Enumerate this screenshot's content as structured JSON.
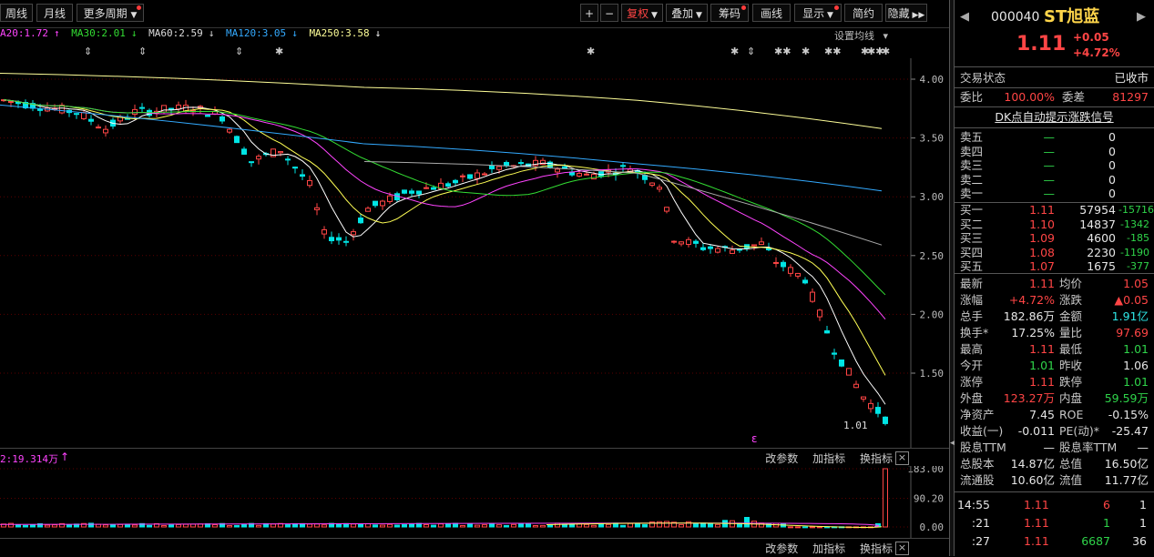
{
  "toolbar": {
    "weekly": "周线",
    "monthly": "月线",
    "more_periods": "更多周期",
    "plus": "+",
    "minus": "−",
    "fuquan": "复权",
    "overlay": "叠加",
    "chips": "筹码",
    "draw": "画线",
    "display": "显示",
    "simple": "简约",
    "hide": "隐藏"
  },
  "ma_row": {
    "ma20": "A20:1.72",
    "ma30": "MA30:2.01",
    "ma60": "MA60:2.59",
    "ma120": "MA120:3.05",
    "ma250": "MA250:3.58",
    "settings": "设置均线"
  },
  "markers": [
    "⇕",
    "⇕",
    "⇕",
    "✱",
    "✱",
    "✱",
    "⇕",
    "✱✱",
    "✱",
    "✱✱",
    "✱",
    "✱✱",
    "✱"
  ],
  "main_chart": {
    "y_ticks": [
      "4.00",
      "3.50",
      "3.00",
      "2.50",
      "2.00",
      "1.50"
    ],
    "low_label": "1.01",
    "ex_marker": "ε"
  },
  "volume": {
    "header": "2:19.314万",
    "y_ticks": [
      "183.00",
      "90.20",
      "0.00"
    ],
    "tools": [
      "改参数",
      "加指标",
      "换指标"
    ],
    "close": "×"
  },
  "stock": {
    "code": "000040",
    "name": "ST旭蓝",
    "price": "1.11",
    "change": "+0.05",
    "change_pct": "+4.72%"
  },
  "status": {
    "label": "交易状态",
    "value": "已收市",
    "weibi_label": "委比",
    "weibi": "100.00%",
    "weicha_label": "委差",
    "weicha": "81297",
    "dk": "DK点自动提示涨跌信号"
  },
  "asks": [
    {
      "label": "卖五",
      "price": "—",
      "vol": "0"
    },
    {
      "label": "卖四",
      "price": "—",
      "vol": "0"
    },
    {
      "label": "卖三",
      "price": "—",
      "vol": "0"
    },
    {
      "label": "卖二",
      "price": "—",
      "vol": "0"
    },
    {
      "label": "卖一",
      "price": "—",
      "vol": "0"
    }
  ],
  "bids": [
    {
      "label": "买一",
      "price": "1.11",
      "vol": "57954",
      "chg": "-15716"
    },
    {
      "label": "买二",
      "price": "1.10",
      "vol": "14837",
      "chg": "-1342"
    },
    {
      "label": "买三",
      "price": "1.09",
      "vol": "4600",
      "chg": "-185"
    },
    {
      "label": "买四",
      "price": "1.08",
      "vol": "2230",
      "chg": "-1190"
    },
    {
      "label": "买五",
      "price": "1.07",
      "vol": "1675",
      "chg": "-377"
    }
  ],
  "stats": [
    {
      "l1": "最新",
      "v1": "1.11",
      "c1": "red",
      "l2": "均价",
      "v2": "1.05",
      "c2": "red"
    },
    {
      "l1": "涨幅",
      "v1": "+4.72%",
      "c1": "red",
      "l2": "涨跌",
      "v2": "▲0.05",
      "c2": "red"
    },
    {
      "l1": "总手",
      "v1": "182.86万",
      "c1": "white",
      "l2": "金额",
      "v2": "1.91亿",
      "c2": "cyan"
    },
    {
      "l1": "换手*",
      "v1": "17.25%",
      "c1": "white",
      "l2": "量比",
      "v2": "97.69",
      "c2": "red"
    },
    {
      "l1": "最高",
      "v1": "1.11",
      "c1": "red",
      "l2": "最低",
      "v2": "1.01",
      "c2": "green"
    },
    {
      "l1": "今开",
      "v1": "1.01",
      "c1": "green",
      "l2": "昨收",
      "v2": "1.06",
      "c2": "white"
    },
    {
      "l1": "涨停",
      "v1": "1.11",
      "c1": "red",
      "l2": "跌停",
      "v2": "1.01",
      "c2": "green"
    },
    {
      "l1": "外盘",
      "v1": "123.27万",
      "c1": "red",
      "l2": "内盘",
      "v2": "59.59万",
      "c2": "green"
    },
    {
      "l1": "净资产",
      "v1": "7.45",
      "c1": "white",
      "l2": "ROE",
      "v2": "-0.15%",
      "c2": "white"
    },
    {
      "l1": "收益(一)",
      "v1": "-0.011",
      "c1": "white",
      "l2": "PE(动)*",
      "v2": "-25.47",
      "c2": "white"
    },
    {
      "l1": "股息TTM",
      "v1": "—",
      "c1": "white",
      "l2": "股息率TTM",
      "v2": "—",
      "c2": "white"
    },
    {
      "l1": "总股本",
      "v1": "14.87亿",
      "c1": "white",
      "l2": "总值",
      "v2": "16.50亿",
      "c2": "white"
    },
    {
      "l1": "流通股",
      "v1": "10.60亿",
      "c1": "white",
      "l2": "流值",
      "v2": "11.77亿",
      "c2": "white"
    }
  ],
  "ticks": [
    {
      "time": "14:55",
      "price": "1.11",
      "vol": "6",
      "n": "1",
      "vc": "red"
    },
    {
      "time": ":21",
      "price": "1.11",
      "vol": "1",
      "n": "1",
      "vc": "green"
    },
    {
      "time": ":27",
      "price": "1.11",
      "vol": "6687",
      "n": "36",
      "vc": "green"
    }
  ],
  "colors": {
    "up": "#ff4545",
    "down": "#00e5e5",
    "ma5": "#ffffff",
    "ma10": "#ffff55",
    "ma20": "#ff44ff",
    "ma30": "#33dd33",
    "ma60": "#aaaaaa",
    "ma120": "#33aaff",
    "ma250": "#ffff99"
  }
}
